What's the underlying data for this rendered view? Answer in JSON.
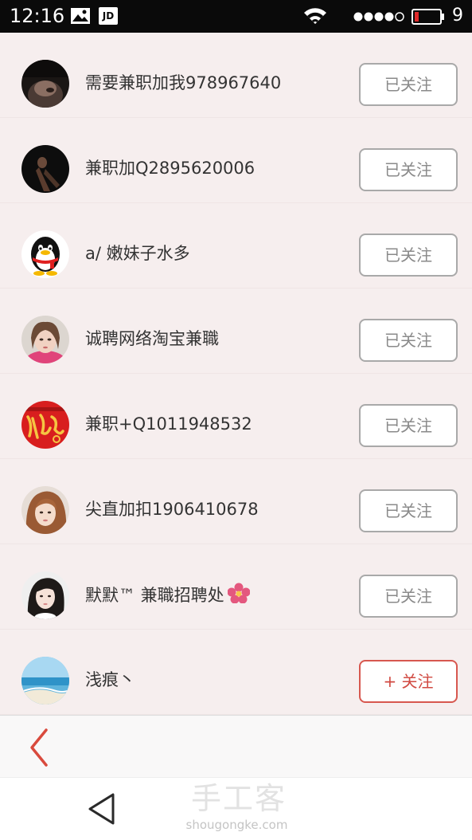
{
  "status_bar": {
    "time": "12:16",
    "notification_icons": [
      "image-icon",
      "jd-app-icon"
    ],
    "jd_label": "JD",
    "battery_level": "9",
    "battery_color": "#e02b2b"
  },
  "follow_list": {
    "items": [
      {
        "name": "需要兼职加我978967640",
        "button": "已关注",
        "followed": true
      },
      {
        "name": "兼职加Q2895620006",
        "button": "已关注",
        "followed": true
      },
      {
        "name": "a/ 嫩妹子水多",
        "button": "已关注",
        "followed": true
      },
      {
        "name": "诚聘网络淘宝兼職",
        "button": "已关注",
        "followed": true
      },
      {
        "name": "兼职+Q1011948532",
        "button": "已关注",
        "followed": true
      },
      {
        "name": "尖直加扣1906410678",
        "button": "已关注",
        "followed": true
      },
      {
        "name": "默默™ 兼職招聘处",
        "button": "已关注",
        "followed": true,
        "trailing_icon": "flower-icon"
      },
      {
        "name": "浅痕丶",
        "button": "+ 关注",
        "followed": false
      }
    ]
  },
  "app_bar": {
    "back_icon": "chevron-left-icon",
    "accent_color": "#d94a3d"
  },
  "nav_bar": {
    "back_icon": "triangle-back-icon"
  },
  "watermark": {
    "title": "手工客",
    "url": "shougongke.com"
  }
}
